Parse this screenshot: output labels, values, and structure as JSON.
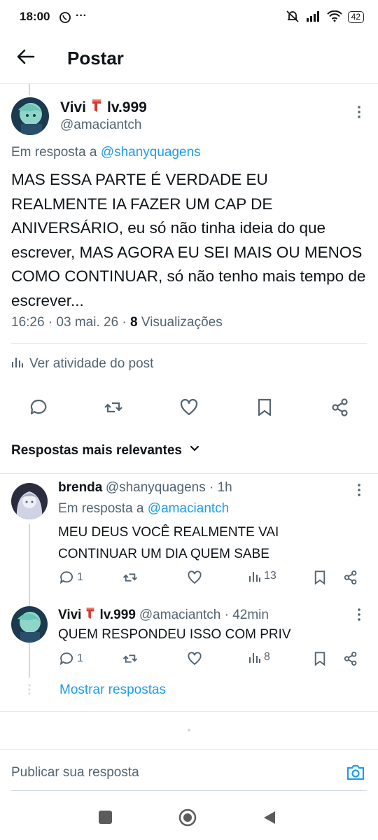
{
  "status": {
    "time": "18:00",
    "battery": "42"
  },
  "header": {
    "title": "Postar"
  },
  "post": {
    "name": "Vivi",
    "badge": "lv.999",
    "handle": "@amaciantch",
    "reply_prefix": "Em resposta a",
    "reply_to": "@shanyquagens",
    "text": "MAS ESSA PARTE É VERDADE EU REALMENTE IA FAZER UM CAP DE ANIVERSÁRIO, eu só não tinha ideia do que escrever, MAS AGORA EU SEI MAIS OU MENOS COMO CONTINUAR, só não tenho mais tempo de escrever...",
    "timestamp": "16:26 · 03 mai. 26 ·",
    "views_count": "8",
    "views_label": "Visualizações",
    "activity_label": "Ver atividade do post"
  },
  "replies_section": {
    "title": "Respostas mais relevantes"
  },
  "replies": [
    {
      "name": "brenda",
      "handle": "@shanyquagens · 1h",
      "reply_prefix": "Em resposta a",
      "reply_to": "@amaciantch",
      "text": "MEU DEUS VOCÊ REALMENTE VAI CONTINUAR UM DIA QUEM SABE",
      "comments": "1",
      "views": "13"
    },
    {
      "name": "Vivi",
      "badge": "lv.999",
      "handle": "@amaciantch · 42min",
      "text": "QUEM RESPONDEU ISSO COM PRIV",
      "comments": "1",
      "views": "8"
    }
  ],
  "show_replies": "Mostrar respostas",
  "composer": {
    "placeholder": "Publicar sua resposta"
  },
  "colors": {
    "accent": "#1d9bf0",
    "muted": "#536471",
    "scarf": "#d9362b"
  }
}
